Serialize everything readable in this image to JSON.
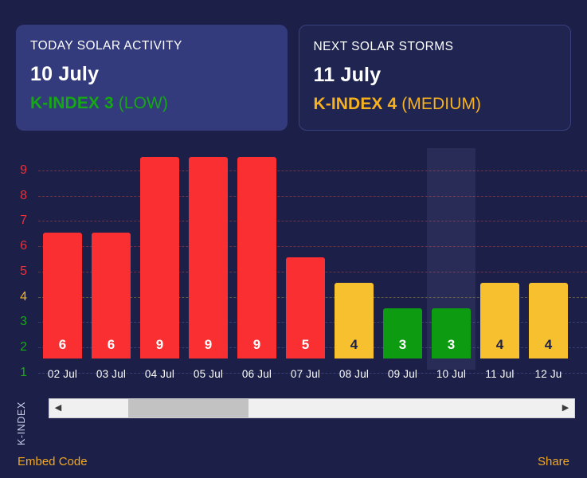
{
  "cards": [
    {
      "title": "TODAY SOLAR ACTIVITY",
      "date": "10 July",
      "k_label": "K-INDEX 3",
      "k_level": "(LOW)",
      "color": "#14a814",
      "style": "today"
    },
    {
      "title": "NEXT SOLAR STORMS",
      "date": "11 July",
      "k_label": "K-INDEX 4",
      "k_level": "(MEDIUM)",
      "color": "#f7b11e",
      "style": "next"
    }
  ],
  "axis_title": "K-INDEX",
  "scrollbar": {
    "left_arrow": "◀",
    "right_arrow": "▶",
    "thumb_position_pct": 12.5,
    "thumb_width_pct": 24.5
  },
  "footer": {
    "embed_label": "Embed Code",
    "share_label": "Share",
    "link_color": "#f2a922"
  },
  "colors": {
    "page_background": "#1c1f47",
    "card_today_background": "#343b7c",
    "card_next_background": "#1f2450",
    "bar_red": "#fa2f32",
    "bar_orange": "#f7c02e",
    "bar_green": "#0d9b12",
    "grid_red": "#8c3a44",
    "grid_orange": "#7d6e3c",
    "grid_purple": "#414a83",
    "highlight_band": "rgba(160,170,225,0.10)"
  },
  "chart_data": {
    "type": "bar",
    "title": "",
    "xlabel": "",
    "ylabel": "K-INDEX",
    "ylim": [
      1,
      9
    ],
    "grid": true,
    "categories": [
      "02 Jul",
      "03 Jul",
      "04 Jul",
      "05 Jul",
      "06 Jul",
      "07 Jul",
      "08 Jul",
      "09 Jul",
      "10 Jul",
      "11 Jul",
      "12 Ju"
    ],
    "values": [
      6,
      6,
      9,
      9,
      9,
      5,
      4,
      3,
      3,
      4,
      4
    ],
    "bar_colors": [
      "#fa2f32",
      "#fa2f32",
      "#fa2f32",
      "#fa2f32",
      "#fa2f32",
      "#fa2f32",
      "#f7c02e",
      "#0d9b12",
      "#0d9b12",
      "#f7c02e",
      "#f7c02e"
    ],
    "value_label_colors": [
      "#ffffff",
      "#ffffff",
      "#ffffff",
      "#ffffff",
      "#ffffff",
      "#ffffff",
      "#1c1f47",
      "#ffffff",
      "#ffffff",
      "#1c1f47",
      "#1c1f47"
    ],
    "highlighted_category": "10 Jul",
    "y_ticks": [
      {
        "label": "9",
        "color": "#e8323c",
        "grid_color": "#8c3a44"
      },
      {
        "label": "8",
        "color": "#e8323c",
        "grid_color": "#8c3a44"
      },
      {
        "label": "7",
        "color": "#e8323c",
        "grid_color": "#8c3a44"
      },
      {
        "label": "6",
        "color": "#e8323c",
        "grid_color": "#8c3a44"
      },
      {
        "label": "5",
        "color": "#e8323c",
        "grid_color": "#8c3a44"
      },
      {
        "label": "4",
        "color": "#f0b429",
        "grid_color": "#7d6e3c"
      },
      {
        "label": "3",
        "color": "#18a818",
        "grid_color": "#414a83"
      },
      {
        "label": "2",
        "color": "#18a818",
        "grid_color": "#414a83"
      },
      {
        "label": "1",
        "color": "#18a818",
        "grid_color": "#414a83"
      }
    ]
  }
}
